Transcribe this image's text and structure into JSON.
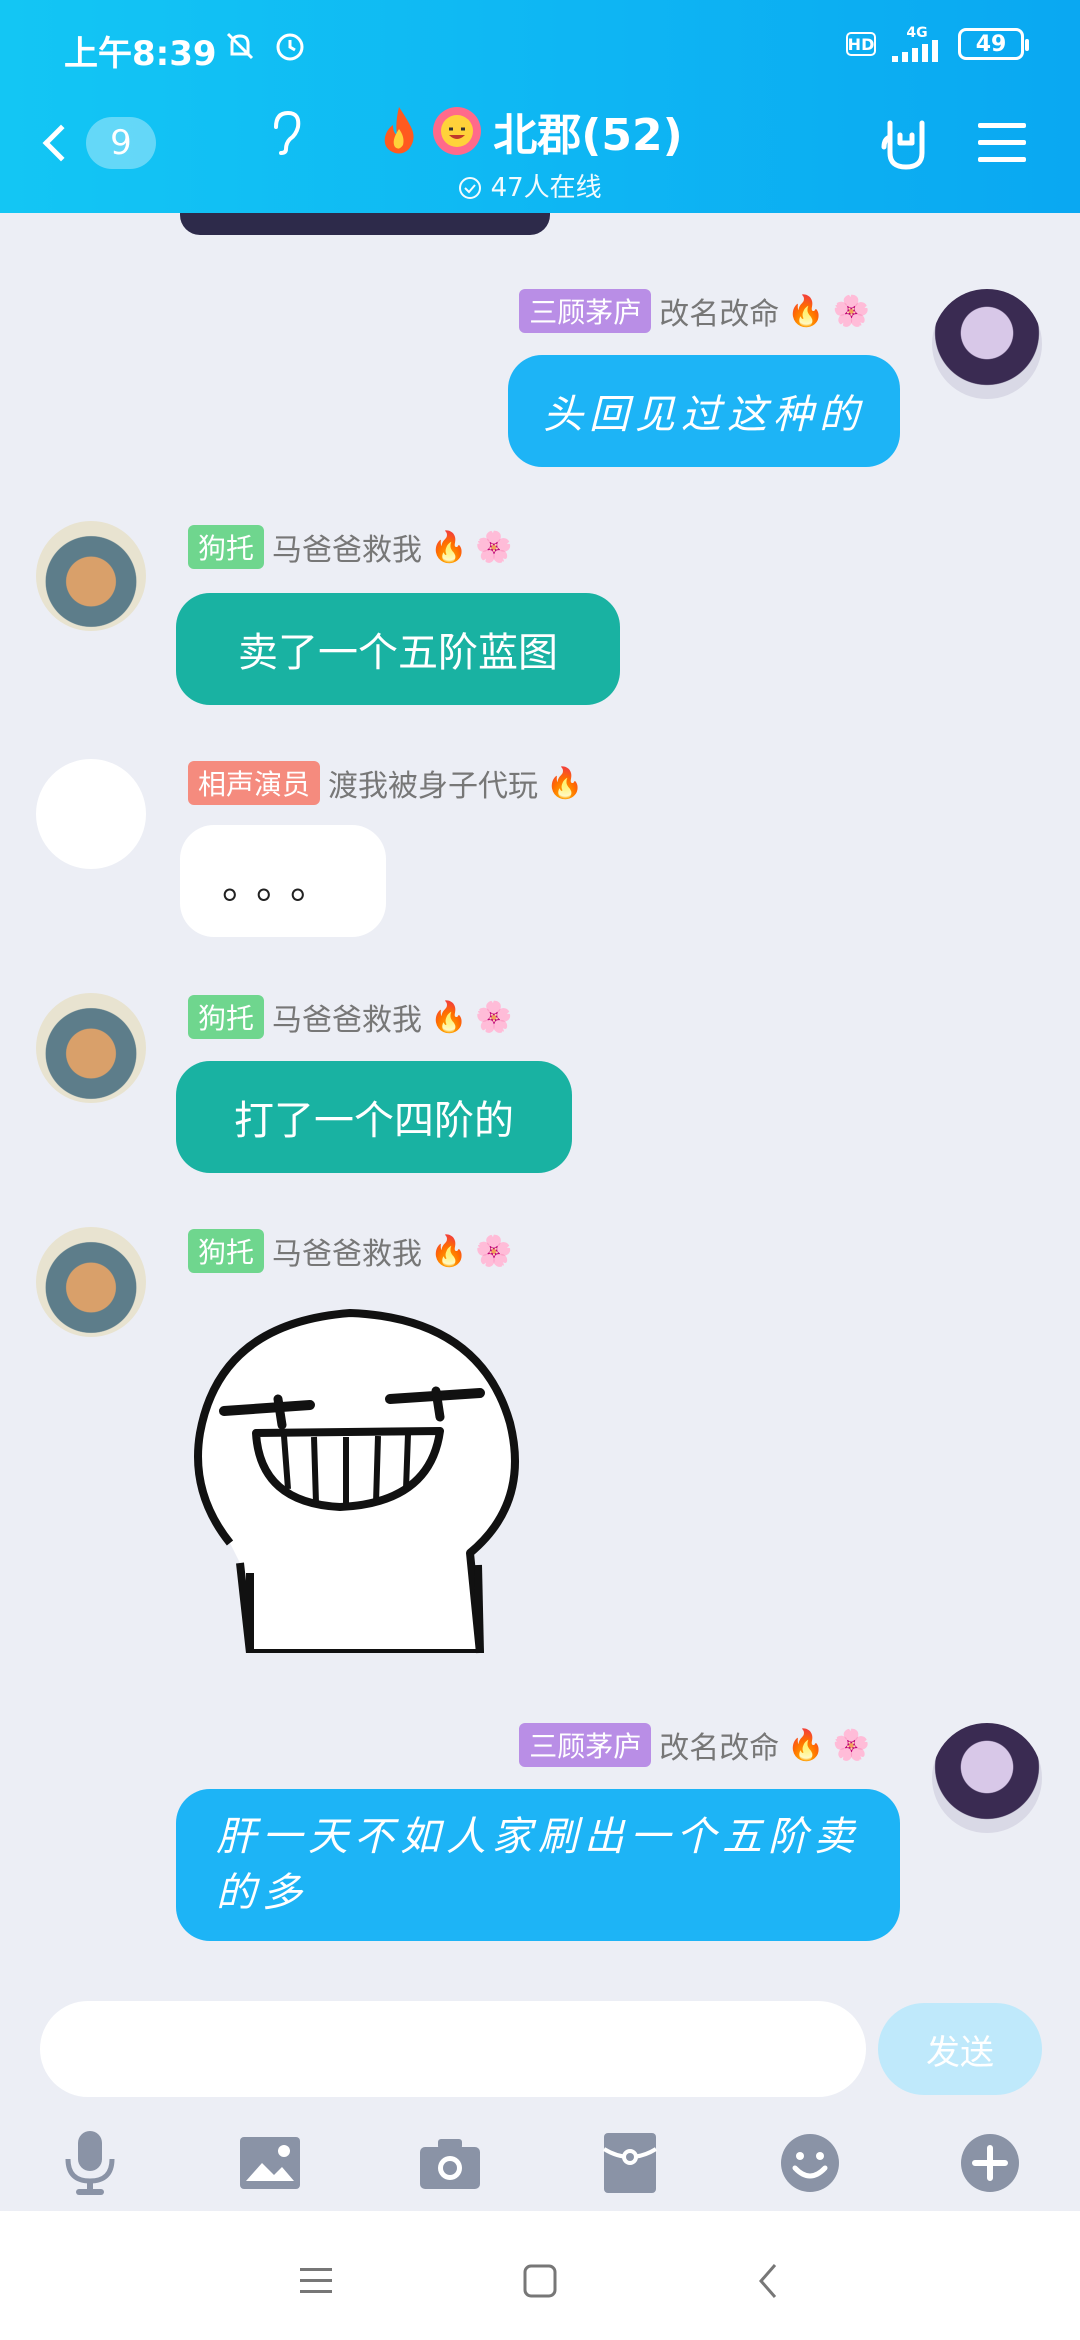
{
  "status_bar": {
    "time": "上午8:39",
    "network": "4G",
    "hd": "HD",
    "battery": "49"
  },
  "header": {
    "back_count": "9",
    "group_name": "北郡(52)",
    "online": "47人在线"
  },
  "messages": [
    {
      "side": "right",
      "tag": "三顾茅庐",
      "name": "改名改命",
      "text": "头回见过这种的"
    },
    {
      "side": "left",
      "tag": "狗托",
      "name": "马爸爸救我",
      "text": "卖了一个五阶蓝图"
    },
    {
      "side": "left",
      "tag": "相声演员",
      "name": "渡我被身子代玩",
      "text": "。。。"
    },
    {
      "side": "left",
      "tag": "狗托",
      "name": "马爸爸救我",
      "text": "打了一个四阶的"
    },
    {
      "side": "left",
      "tag": "狗托",
      "name": "马爸爸救我",
      "text": ""
    },
    {
      "side": "right",
      "tag": "三顾茅庐",
      "name": "改名改命",
      "text": "肝一天不如人家刷出一个五阶卖的多"
    }
  ],
  "input": {
    "placeholder": "",
    "send_label": "发送"
  },
  "colors": {
    "header": "#0aa8f2",
    "bubble_blue": "#1db4f6",
    "bubble_teal": "#19b2a2",
    "tag_purple": "#b98ee6",
    "tag_green": "#6fd68e",
    "tag_red": "#f58b7e"
  },
  "icons": [
    "mic-icon",
    "image-icon",
    "camera-icon",
    "red-packet-icon",
    "emoji-icon",
    "plus-icon"
  ]
}
